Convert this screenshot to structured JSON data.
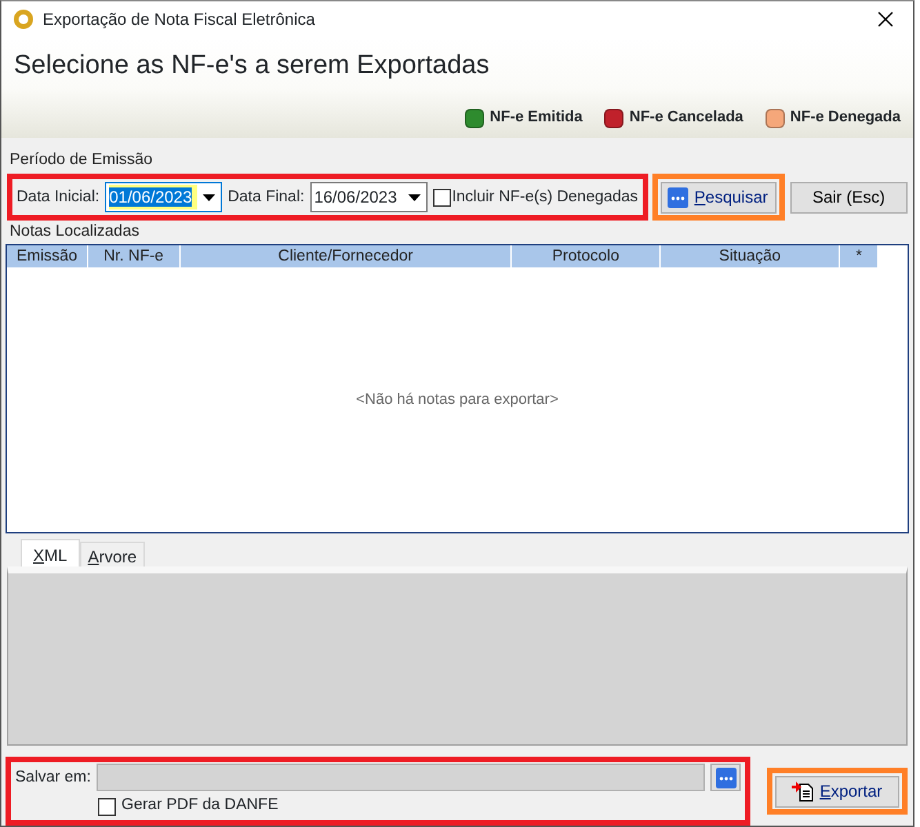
{
  "window": {
    "title": "Exportação de Nota Fiscal Eletrônica"
  },
  "header": {
    "title": "Selecione as NF-e's a serem Exportadas",
    "legend": [
      {
        "label": "NF-e Emitida",
        "color": "#2e8b2e"
      },
      {
        "label": "NF-e Cancelada",
        "color": "#c0212b"
      },
      {
        "label": "NF-e Denegada",
        "color": "#f5a77a"
      }
    ]
  },
  "period": {
    "label": "Período de Emissão",
    "color": "#ee1c24",
    "start_label": "Data Inicial:",
    "start_value": "01/06/2023",
    "start_selected": true,
    "end_label": "Data Final:",
    "end_value": "16/06/2023",
    "include_denied": {
      "label": "Incluir NF-e(s) Denegadas",
      "checked": false
    }
  },
  "actions": {
    "color": "#ff7f27",
    "buttons": [
      {
        "label": "Pesquisar",
        "mnemonic": true,
        "kind": "ellipsis"
      },
      {
        "label": "Sair (Esc)",
        "mnemonic": false,
        "kind": "plain"
      }
    ]
  },
  "notes": {
    "label": "Notas Localizadas",
    "columns": [
      "Emissão",
      "Nr. NF-e",
      "Cliente/Fornecedor",
      "Protocolo",
      "Situação",
      "*"
    ],
    "empty_text": "<Não há notas para exportar>"
  },
  "tabs": [
    {
      "label": "XML",
      "selected": true,
      "mnemonic": true
    },
    {
      "label": "Arvore",
      "selected": false,
      "mnemonic": true
    }
  ],
  "save": {
    "color": "#ee1c24",
    "label": "Salvar em:",
    "pdf": {
      "label": "Gerar PDF da DANFE",
      "checked": false
    }
  },
  "export": {
    "color": "#ff7f27",
    "label": "Exportar",
    "mnemonic": true
  }
}
